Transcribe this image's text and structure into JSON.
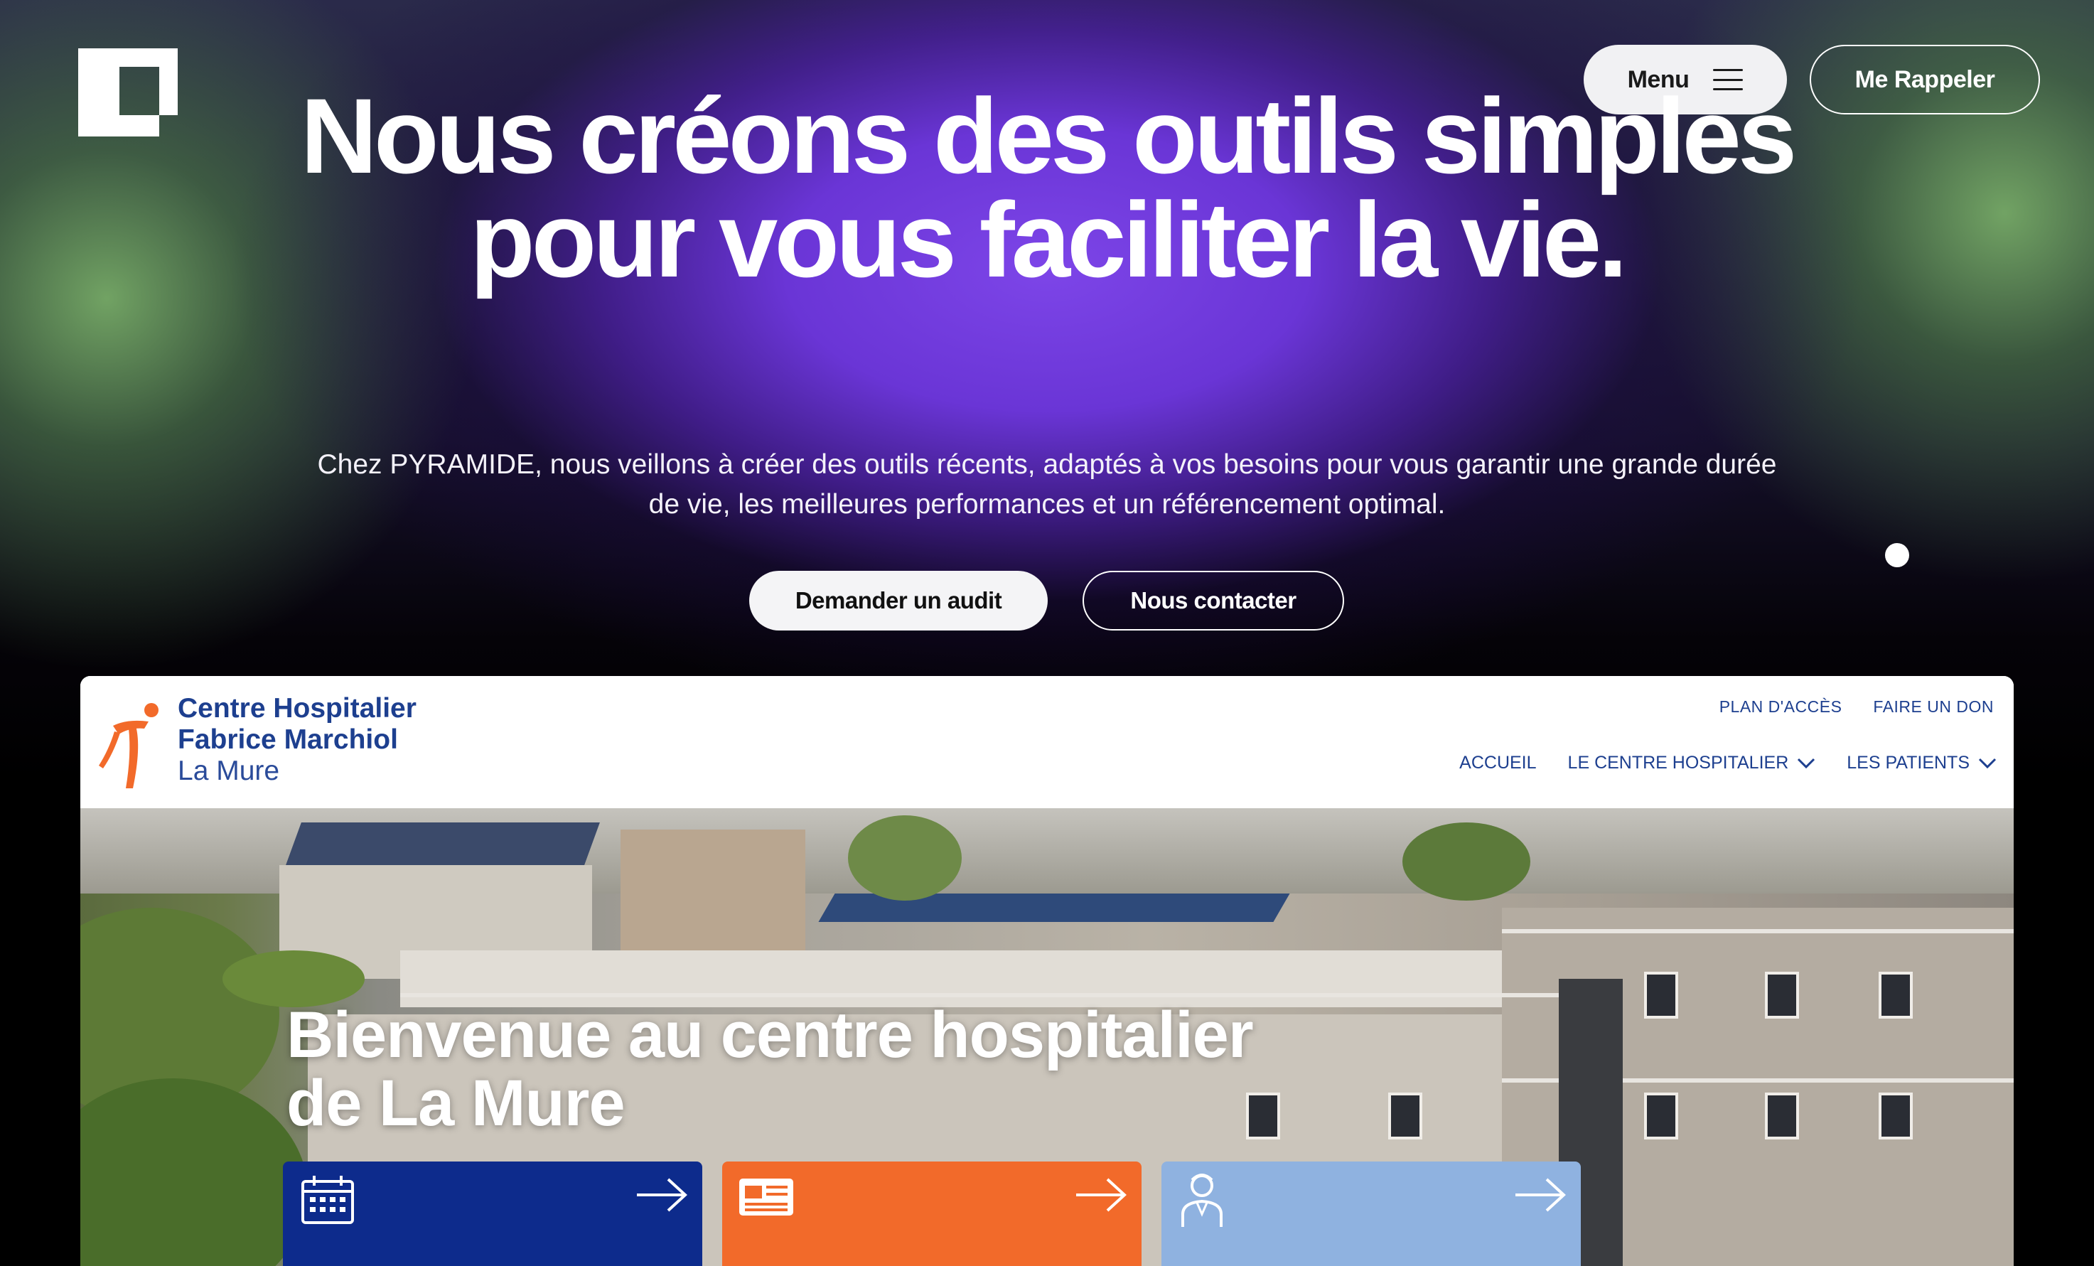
{
  "header": {
    "menu_label": "Menu",
    "call_label": "Me Rappeler"
  },
  "hero": {
    "title": "Nous créons des outils simples pour vous faciliter la vie.",
    "subtitle": "Chez PYRAMIDE, nous veillons à créer des outils récents, adaptés à vos besoins pour vous garantir une grande durée de vie, les meilleures performances et un référencement optimal.",
    "audit_button": "Demander un audit",
    "contact_button": "Nous contacter"
  },
  "preview": {
    "logo_line1": "Centre Hospitalier",
    "logo_line2": "Fabrice Marchiol",
    "logo_line3": "La Mure",
    "top_links": [
      "PLAN D'ACCÈS",
      "FAIRE UN DON"
    ],
    "nav": [
      "ACCUEIL",
      "LE CENTRE HOSPITALIER",
      "LES PATIENTS"
    ],
    "headline": "Bienvenue au centre hospitalier de La Mure",
    "cards": [
      {
        "icon": "calendar-icon",
        "color": "#0d2b8c"
      },
      {
        "icon": "newspaper-icon",
        "color": "#f26a2a"
      },
      {
        "icon": "doctor-icon",
        "color": "#8fb2e0"
      }
    ]
  },
  "colors": {
    "accent_purple": "#7d45e8",
    "accent_green": "#76aa66",
    "hospital_blue": "#1d3f8f",
    "hospital_orange": "#f26a2a"
  }
}
